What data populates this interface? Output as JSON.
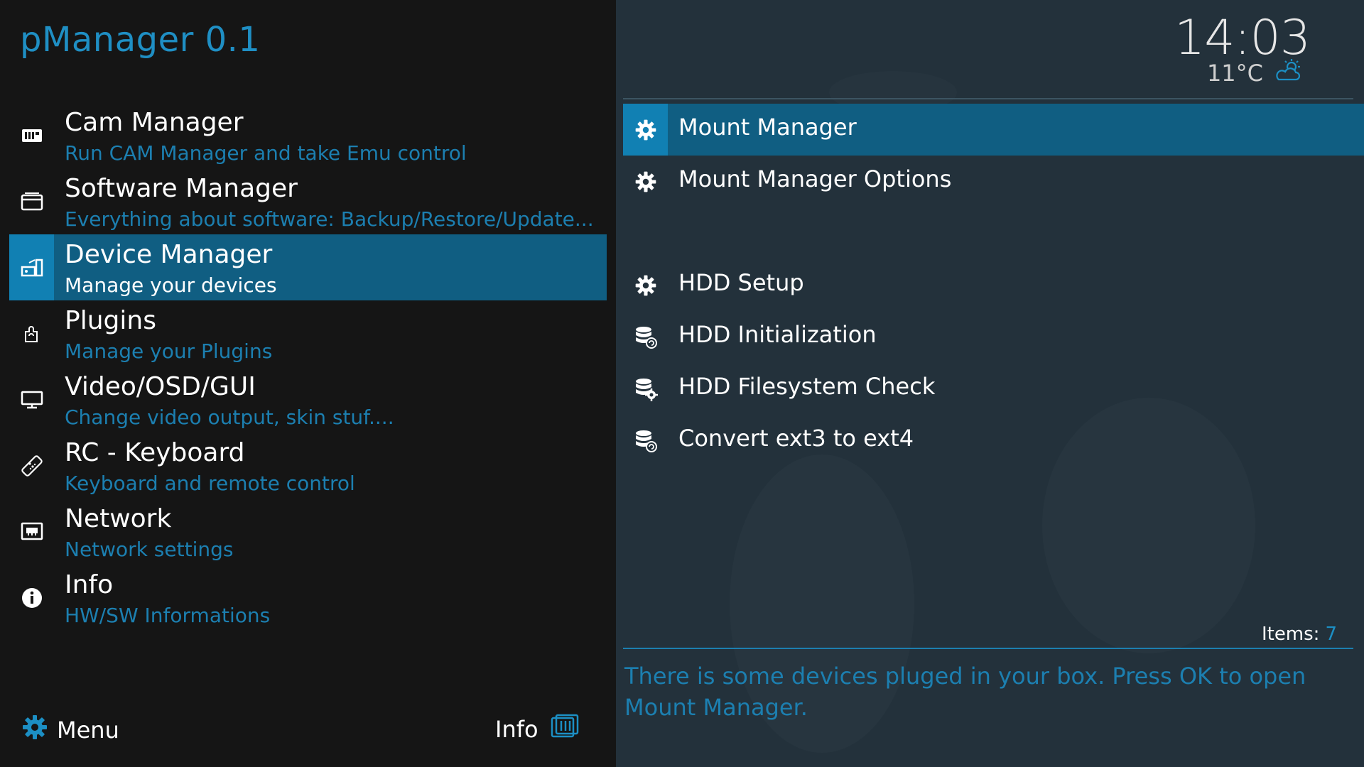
{
  "app": {
    "title": "pManager 0.1"
  },
  "main_menu": [
    {
      "label": "Cam Manager",
      "desc": "Run CAM Manager and take Emu control",
      "icon": "cam-icon",
      "selected": false
    },
    {
      "label": "Software Manager",
      "desc": "Everything about software: Backup/Restore/Update...",
      "icon": "software-icon",
      "selected": false
    },
    {
      "label": "Device Manager",
      "desc": "Manage your devices",
      "icon": "device-icon",
      "selected": true
    },
    {
      "label": "Plugins",
      "desc": "Manage your Plugins",
      "icon": "plugin-icon",
      "selected": false
    },
    {
      "label": "Video/OSD/GUI",
      "desc": "Change video output, skin stuf....",
      "icon": "monitor-icon",
      "selected": false
    },
    {
      "label": "RC - Keyboard",
      "desc": "Keyboard and remote control",
      "icon": "remote-icon",
      "selected": false
    },
    {
      "label": "Network",
      "desc": "Network settings",
      "icon": "network-icon",
      "selected": false
    },
    {
      "label": "Info",
      "desc": "HW/SW Informations",
      "icon": "info-icon",
      "selected": false
    }
  ],
  "footer": {
    "menu_label": "Menu",
    "info_label": "Info"
  },
  "status": {
    "time": "14:03",
    "temperature": "11°C",
    "weather_icon": "partly-cloudy-icon"
  },
  "sub_menu": [
    {
      "label": "Mount Manager",
      "icon": "gear-icon",
      "selected": true
    },
    {
      "label": "Mount Manager Options",
      "icon": "gear-icon",
      "selected": false
    },
    {
      "label": "HDD Setup",
      "icon": "gear-icon",
      "selected": false
    },
    {
      "label": "HDD Initialization",
      "icon": "database-refresh-icon",
      "selected": false
    },
    {
      "label": "HDD Filesystem Check",
      "icon": "database-gear-icon",
      "selected": false
    },
    {
      "label": "Convert ext3 to ext4",
      "icon": "database-refresh-icon",
      "selected": false
    }
  ],
  "items": {
    "label": "Items:",
    "count": "7"
  },
  "description": "There is some devices pluged in your box. Press OK to open Mount Manager.",
  "colors": {
    "accent": "#1180b3",
    "selected_bg": "#105e82",
    "desc_text": "#1c7fb0",
    "right_bg": "#23313b"
  }
}
